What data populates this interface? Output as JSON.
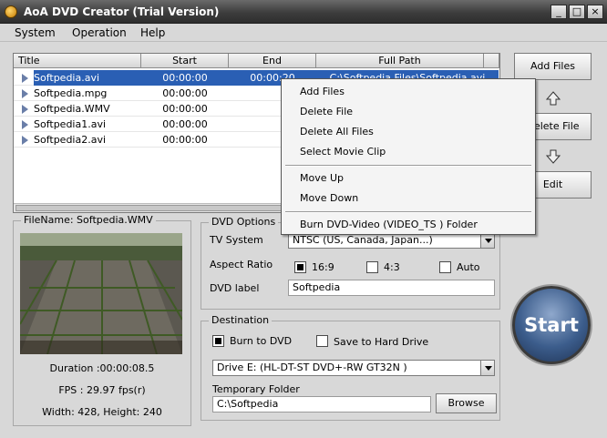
{
  "window": {
    "title": "AoA DVD Creator (Trial Version)",
    "minimize": "_",
    "maximize": "□",
    "close": "×"
  },
  "menu": {
    "system": "System",
    "operation": "Operation",
    "help": "Help"
  },
  "table": {
    "headers": {
      "title": "Title",
      "start": "Start",
      "end": "End",
      "path": "Full Path"
    },
    "rows": [
      {
        "title": "Softpedia.avi",
        "start": "00:00:00",
        "end": "00:00:20",
        "path": "C:\\Softpedia Files\\Softpedia.avi"
      },
      {
        "title": "Softpedia.mpg",
        "start": "00:00:00",
        "end": "",
        "path": ""
      },
      {
        "title": "Softpedia.WMV",
        "start": "00:00:00",
        "end": "",
        "path": ""
      },
      {
        "title": "Softpedia1.avi",
        "start": "00:00:00",
        "end": "",
        "path": ""
      },
      {
        "title": "Softpedia2.avi",
        "start": "00:00:00",
        "end": "",
        "path": ""
      }
    ]
  },
  "side_buttons": {
    "add_files": "Add Files",
    "delete_file": "Delete File",
    "edit": "Edit"
  },
  "context_menu": {
    "add_files": "Add Files",
    "delete_file": "Delete File",
    "delete_all": "Delete All Files",
    "select_clip": "Select Movie Clip",
    "move_up": "Move Up",
    "move_down": "Move Down",
    "burn": "Burn DVD-Video (VIDEO_TS ) Folder"
  },
  "preview": {
    "filename_label": "FileName: Softpedia.WMV",
    "duration": "Duration :00:00:08.5",
    "fps": "FPS : 29.97 fps(r)",
    "size": "Width: 428, Height: 240"
  },
  "dvd_options": {
    "group_label": "DVD Options",
    "tv_system_label": "TV System",
    "tv_system_value": "NTSC (US, Canada, Japan...)",
    "aspect_label": "Aspect Ratio",
    "aspect_16_9": "16:9",
    "aspect_4_3": "4:3",
    "aspect_auto": "Auto",
    "dvd_label": "DVD label",
    "dvd_label_value": "Softpedia"
  },
  "destination": {
    "group_label": "Destination",
    "burn_label": "Burn to DVD",
    "save_label": "Save to Hard Drive",
    "drive_value": "Drive E: (HL-DT-ST DVD+-RW GT32N   )",
    "temp_label": "Temporary Folder",
    "temp_value": "C:\\Softpedia",
    "browse": "Browse"
  },
  "start_button": "Start"
}
